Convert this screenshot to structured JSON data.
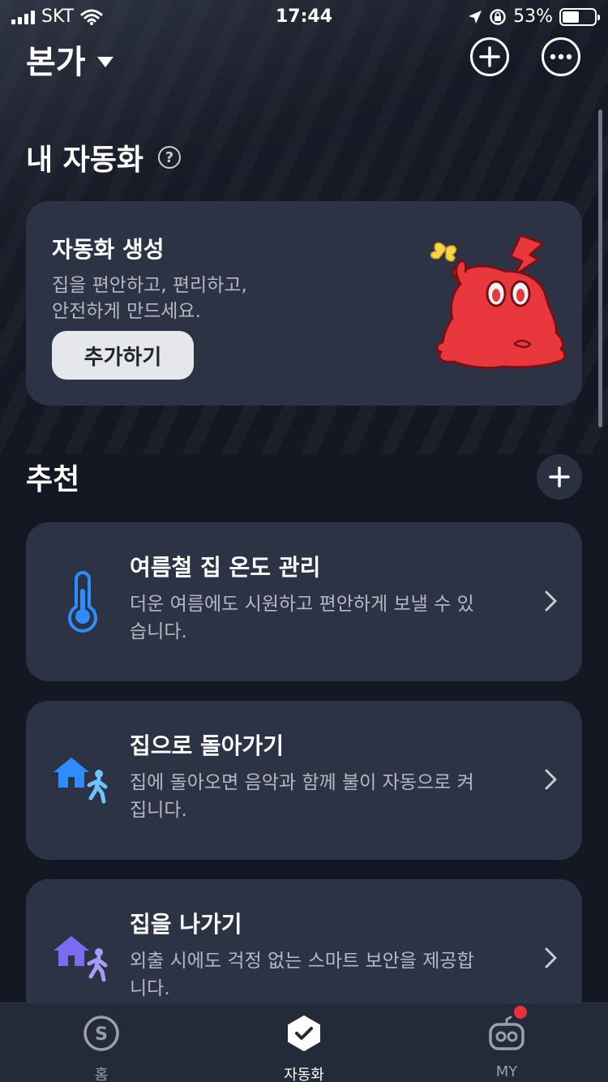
{
  "status_bar": {
    "carrier": "SKT",
    "time": "17:44",
    "battery_percent": "53%",
    "battery_level": 0.53
  },
  "header": {
    "location": "본가"
  },
  "my_automations": {
    "title": "내 자동화",
    "help_label": "?",
    "create_card": {
      "title": "자동화 생성",
      "description": "집을 편안하고, 편리하고,\n안전하게 만드세요.",
      "button_label": "추가하기"
    }
  },
  "recommendations": {
    "title": "추천",
    "items": [
      {
        "title": "여름철 집 온도 관리",
        "description": "더운 여름에도 시원하고 편안하게 보낼 수 있습니다.",
        "icon": "thermometer-icon"
      },
      {
        "title": "집으로 돌아가기",
        "description": "집에 돌아오면 음악과 함께 불이 자동으로 켜집니다.",
        "icon": "home-arrive-icon"
      },
      {
        "title": "집을 나가기",
        "description": "외출 시에도 걱정 없는 스마트 보안을 제공합니다.",
        "icon": "home-leave-icon"
      }
    ]
  },
  "tabbar": {
    "tabs": [
      {
        "label": "홈",
        "icon": "smartthings-icon",
        "active": false
      },
      {
        "label": "자동화",
        "icon": "automation-check-icon",
        "active": true
      },
      {
        "label": "MY",
        "icon": "robot-icon",
        "active": false,
        "badge": true
      }
    ]
  },
  "colors": {
    "background": "#141823",
    "card": "#2b3345",
    "accent_blue": "#2f8cff",
    "badge_red": "#e8323c"
  }
}
